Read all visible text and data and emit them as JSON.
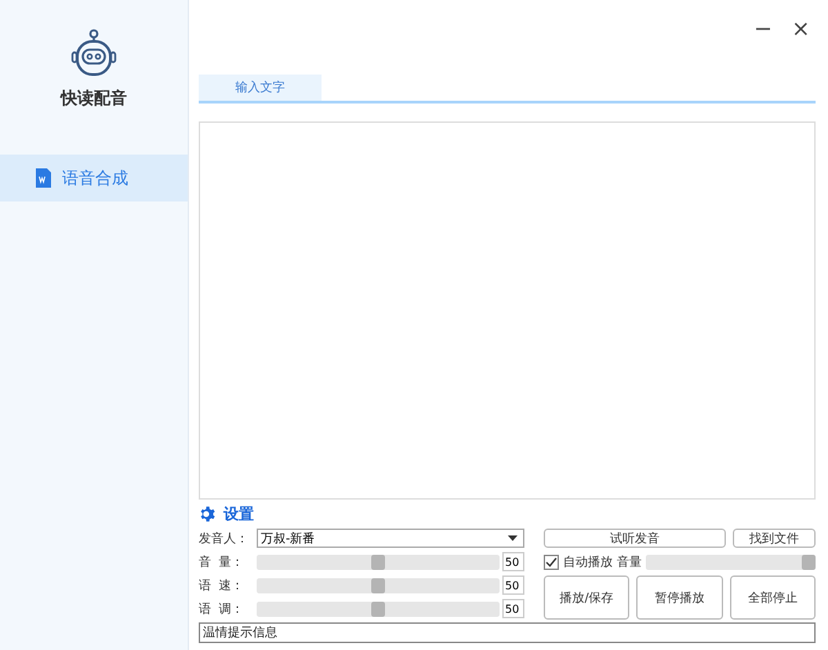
{
  "app": {
    "name": "快读配音"
  },
  "sidebar": {
    "items": [
      {
        "label": "语音合成",
        "selected": true
      }
    ]
  },
  "window_controls": [
    "−",
    "×"
  ],
  "tabs": [
    {
      "label": "输入文字",
      "selected": true
    }
  ],
  "settings": {
    "title": "设置",
    "voice": {
      "label": "发音人：",
      "value": "万叔-新番"
    },
    "sliders": [
      {
        "label": "音  量：",
        "level": 0.5,
        "reading": "50"
      },
      {
        "label": "语  速：",
        "level": 0.5,
        "reading": "50"
      },
      {
        "label": "语  调：",
        "level": 0.5,
        "reading": "50"
      }
    ],
    "status": {
      "placeholder": "温情提示信息"
    }
  },
  "actions": {
    "preview_button": "试听发音",
    "find_file_button": "找到文件",
    "auto_play": {
      "label": "自动播放",
      "checked": true
    },
    "volume": {
      "label": "音量",
      "level": 1.0
    },
    "buttons": [
      "播放/保存",
      "暂停播放",
      "全部停止"
    ]
  }
}
